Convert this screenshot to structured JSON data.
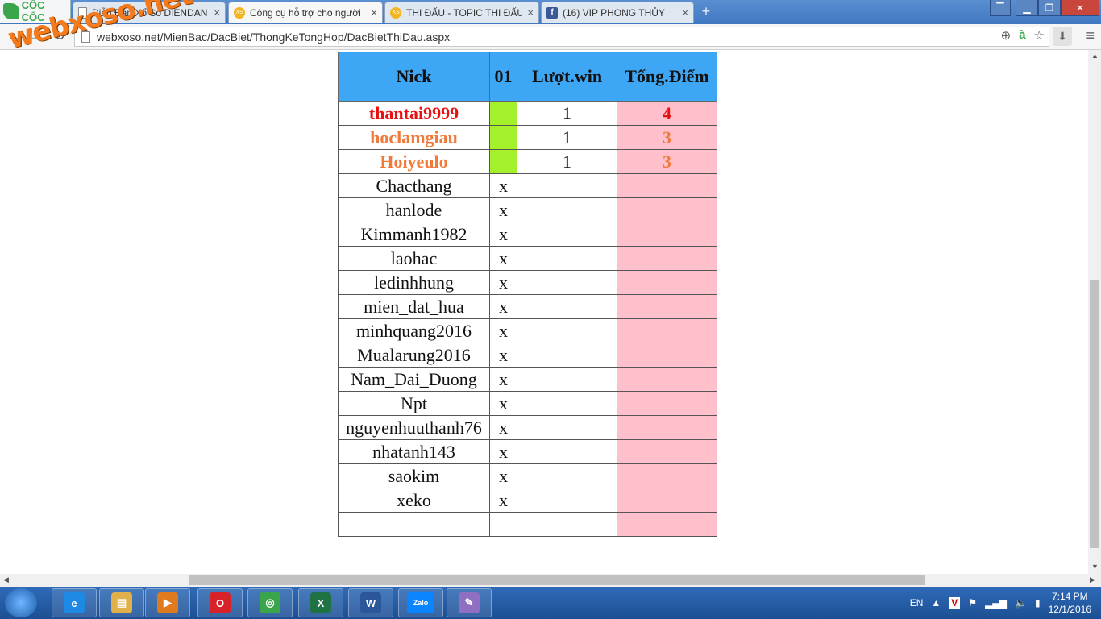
{
  "browser": {
    "brand_label": "CỐC CỐC",
    "tabs": [
      {
        "title": "Diễn Đàn Xổ Số DIENDAN",
        "icon": "page-icon",
        "active": false
      },
      {
        "title": "Công cụ hỗ trợ cho người",
        "icon": "xs-icon",
        "active": true
      },
      {
        "title": "THI ĐẤU - TOPIC THI ĐẤU",
        "icon": "xs-icon",
        "active": false
      },
      {
        "title": "(16) VIP PHONG THỦY",
        "icon": "facebook-icon",
        "active": false
      }
    ],
    "tab_close": "×",
    "new_tab": "+",
    "url": "webxoso.net/MienBac/DacBiet/ThongKeTongHop/DacBietThiDau.aspx",
    "nav": {
      "back": "←",
      "forward": "→",
      "reload": "↻"
    },
    "window_controls": {
      "minimize": "▁",
      "restore": "❐",
      "close": "✕",
      "extra": "▔"
    }
  },
  "watermark": "webxoso.net",
  "table": {
    "headers": [
      "Nick",
      "01",
      "Lượt.win",
      "Tổng.Điểm"
    ],
    "rows": [
      {
        "nick": "thantai9999",
        "mark": "",
        "wins": "1",
        "points": "4",
        "highlight": "red"
      },
      {
        "nick": "hoclamgiau",
        "mark": "",
        "wins": "1",
        "points": "3",
        "highlight": "orange"
      },
      {
        "nick": "Hoiyeulo",
        "mark": "",
        "wins": "1",
        "points": "3",
        "highlight": "orange"
      },
      {
        "nick": "Chacthang",
        "mark": "x",
        "wins": "",
        "points": "",
        "highlight": ""
      },
      {
        "nick": "hanlode",
        "mark": "x",
        "wins": "",
        "points": "",
        "highlight": ""
      },
      {
        "nick": "Kimmanh1982",
        "mark": "x",
        "wins": "",
        "points": "",
        "highlight": ""
      },
      {
        "nick": "laohac",
        "mark": "x",
        "wins": "",
        "points": "",
        "highlight": ""
      },
      {
        "nick": "ledinhhung",
        "mark": "x",
        "wins": "",
        "points": "",
        "highlight": ""
      },
      {
        "nick": "mien_dat_hua",
        "mark": "x",
        "wins": "",
        "points": "",
        "highlight": ""
      },
      {
        "nick": "minhquang2016",
        "mark": "x",
        "wins": "",
        "points": "",
        "highlight": ""
      },
      {
        "nick": "Mualarung2016",
        "mark": "x",
        "wins": "",
        "points": "",
        "highlight": ""
      },
      {
        "nick": "Nam_Dai_Duong",
        "mark": "x",
        "wins": "",
        "points": "",
        "highlight": ""
      },
      {
        "nick": "Npt",
        "mark": "x",
        "wins": "",
        "points": "",
        "highlight": ""
      },
      {
        "nick": "nguyenhuuthanh76",
        "mark": "x",
        "wins": "",
        "points": "",
        "highlight": ""
      },
      {
        "nick": "nhatanh143",
        "mark": "x",
        "wins": "",
        "points": "",
        "highlight": ""
      },
      {
        "nick": "saokim",
        "mark": "x",
        "wins": "",
        "points": "",
        "highlight": ""
      },
      {
        "nick": "xeko",
        "mark": "x",
        "wins": "",
        "points": "",
        "highlight": ""
      },
      {
        "nick": "",
        "mark": "",
        "wins": "",
        "points": "",
        "highlight": ""
      }
    ],
    "colors": {
      "header": "#3ea7f5",
      "win_cell": "#a4f12b",
      "points_col": "#ffc0cb",
      "rank1": "#e81010",
      "rank2": "#f07a3a"
    }
  },
  "taskbar": {
    "apps": [
      "internet-explorer",
      "file-explorer",
      "media-player",
      "opera",
      "coc-coc",
      "excel",
      "word",
      "zalo",
      "paint"
    ],
    "app_glyphs": [
      "e",
      "▤",
      "▶",
      "O",
      "◎",
      "X",
      "W",
      "Zalo",
      "✎"
    ],
    "language": "EN",
    "time": "7:14 PM",
    "date": "12/1/2016"
  }
}
